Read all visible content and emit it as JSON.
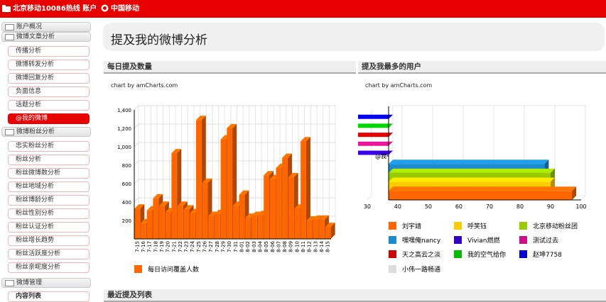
{
  "topbar": {
    "account_label": "北京移动10086热线 账户",
    "brand_label": "中国移动"
  },
  "sidebar": {
    "sections": [
      {
        "label": "账户概况",
        "items": []
      },
      {
        "label": "微博文章分析",
        "items": [
          "传播分析",
          "微博转发分析",
          "微博回复分析",
          "负面信息",
          "话题分析",
          "@我的微博"
        ]
      },
      {
        "label": "微博粉丝分析",
        "items": [
          "忠实粉丝分析",
          "粉丝分析",
          "粉丝微博数分析",
          "粉丝地域分析",
          "粉丝博龄分析",
          "粉丝性别分析",
          "粉丝认证分析",
          "粉丝增长趋势",
          "粉丝活跃度分析",
          "粉丝亲昵度分析"
        ]
      },
      {
        "label": "微博管理",
        "items": [
          "内容列表"
        ]
      }
    ],
    "active_item": "@我的微博"
  },
  "header": {
    "title": "提及我的微博分析"
  },
  "panels": {
    "daily": {
      "title": "每日提及数量",
      "credit": "chart by amCharts.com"
    },
    "users": {
      "title": "提及我最多的用户",
      "credit": "chart by amCharts.com"
    },
    "recent": {
      "title": "最近提及列表"
    }
  },
  "chart_data": [
    {
      "type": "bar",
      "categories": [
        "7-15",
        "7-16",
        "7-17",
        "7-18",
        "7-19",
        "7-20",
        "7-21",
        "7-22",
        "7-23",
        "7-24",
        "7-25",
        "7-26",
        "7-27",
        "7-28",
        "7-29",
        "7-30",
        "7-31",
        "8-01",
        "8-02",
        "8-03",
        "8-04",
        "8-05",
        "8-06",
        "8-07",
        "8-08",
        "8-09",
        "8-10",
        "8-11",
        "8-12",
        "8-13",
        "8-14",
        "8-15"
      ],
      "series": [
        {
          "name": "每日访问覆盖人数",
          "values": [
            330,
            170,
            310,
            440,
            360,
            290,
            930,
            360,
            320,
            280,
            1290,
            610,
            250,
            270,
            1080,
            1200,
            360,
            480,
            230,
            250,
            260,
            690,
            650,
            770,
            880,
            670,
            330,
            1060,
            200,
            210,
            210,
            130
          ]
        }
      ],
      "ylim": [
        0,
        1400
      ],
      "yticks": [
        "200",
        "400",
        "600",
        "800",
        "1,000",
        "1,200",
        "1,400"
      ],
      "legend_position": "bottom-left",
      "bar_color": "#ff6600"
    },
    {
      "type": "bar",
      "orientation": "horizontal",
      "categories": [
        "刘宇靖",
        "呼笑钰",
        "北京移动粉丝团",
        "嘿嘿俺nancy",
        "Vivian燃燃",
        "测试过去",
        "天之高云之淡",
        "我的空气给你",
        "赵坤7758",
        "小伟一路畅通"
      ],
      "values": [
        97,
        90,
        90,
        88,
        20,
        20,
        20,
        16,
        13,
        6
      ],
      "colors": [
        "#ff6600",
        "#ffcc00",
        "#99cc00",
        "#1b8bd0",
        "#3300cc",
        "#cc1188",
        "#cc0000",
        "#00bb00",
        "#0000cc",
        "#dddddd"
      ],
      "xlim": [
        20,
        100
      ],
      "xticks": [
        30,
        40,
        50,
        60,
        70,
        80,
        90,
        100
      ],
      "ytick_label": "@我",
      "legend_position": "bottom",
      "grid": true
    }
  ]
}
